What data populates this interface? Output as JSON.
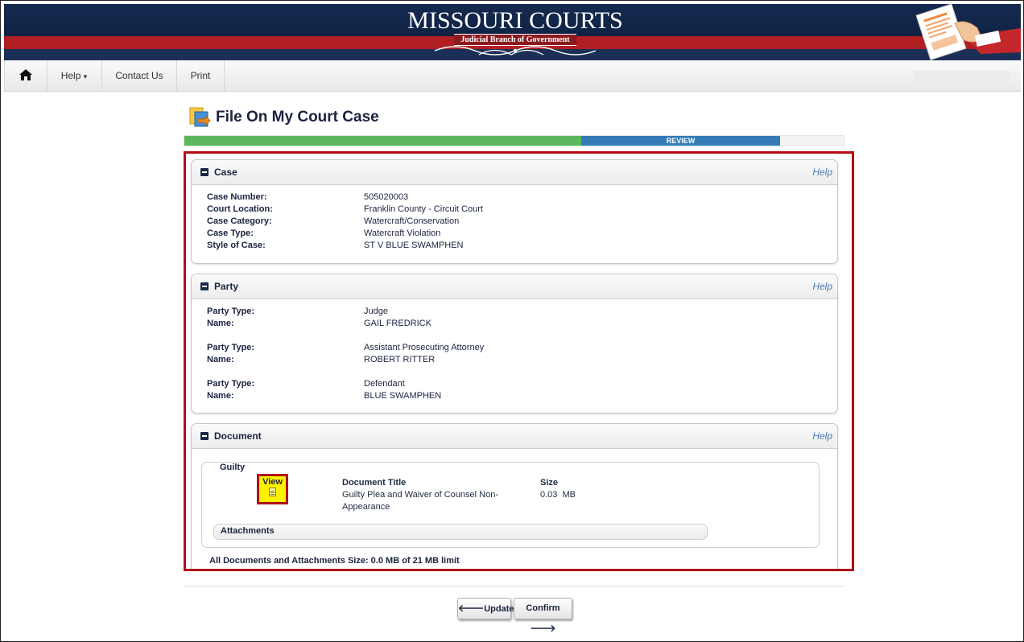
{
  "banner": {
    "logo_title": "MISSOURI COURTS",
    "logo_subtitle": "Judicial Branch of Government"
  },
  "nav": {
    "home_icon": "home-icon",
    "help": "Help",
    "help_caret": "▾",
    "contact": "Contact Us",
    "print": "Print"
  },
  "page": {
    "title": "File On My Court Case",
    "progress_current_step": "REVIEW",
    "progress_fraction_complete": 0.6
  },
  "case_panel": {
    "title": "Case",
    "help": "Help",
    "fields": [
      {
        "label": "Case Number:",
        "value": "505020003"
      },
      {
        "label": "Court Location:",
        "value": "Franklin County - Circuit Court"
      },
      {
        "label": "Case Category:",
        "value": "Watercraft/Conservation"
      },
      {
        "label": "Case Type:",
        "value": "Watercraft Violation"
      },
      {
        "label": "Style of Case:",
        "value": "ST V BLUE SWAMPHEN"
      }
    ]
  },
  "party_panel": {
    "title": "Party",
    "help": "Help",
    "parties": [
      {
        "type_label": "Party Type:",
        "type": "Judge",
        "name_label": "Name:",
        "name": "GAIL FREDRICK"
      },
      {
        "type_label": "Party Type:",
        "type": "Assistant Prosecuting Attorney",
        "name_label": "Name:",
        "name": "ROBERT RITTER"
      },
      {
        "type_label": "Party Type:",
        "type": "Defendant",
        "name_label": "Name:",
        "name": "BLUE SWAMPHEN"
      }
    ]
  },
  "document_panel": {
    "title": "Document",
    "help": "Help",
    "group_legend": "Guilty",
    "view_label": "View",
    "doc_title_header": "Document Title",
    "doc_title_line1": "Guilty Plea and Waiver of Counsel Non-",
    "doc_title_line2": "Appearance",
    "size_header": "Size",
    "size_value": "0.03  MB",
    "attachments_label": "Attachments",
    "summary": "All Documents and Attachments Size: 0.0 MB of 21 MB limit"
  },
  "buttons": {
    "update_arrow": "🡐",
    "update": "Update",
    "confirm": "Confirm",
    "confirm_arrow": "🡒"
  },
  "colors": {
    "progress_done": "#5cb85c",
    "progress_current": "#337ab7",
    "highlight": "#b10f14",
    "view_highlight": "#fff200"
  }
}
